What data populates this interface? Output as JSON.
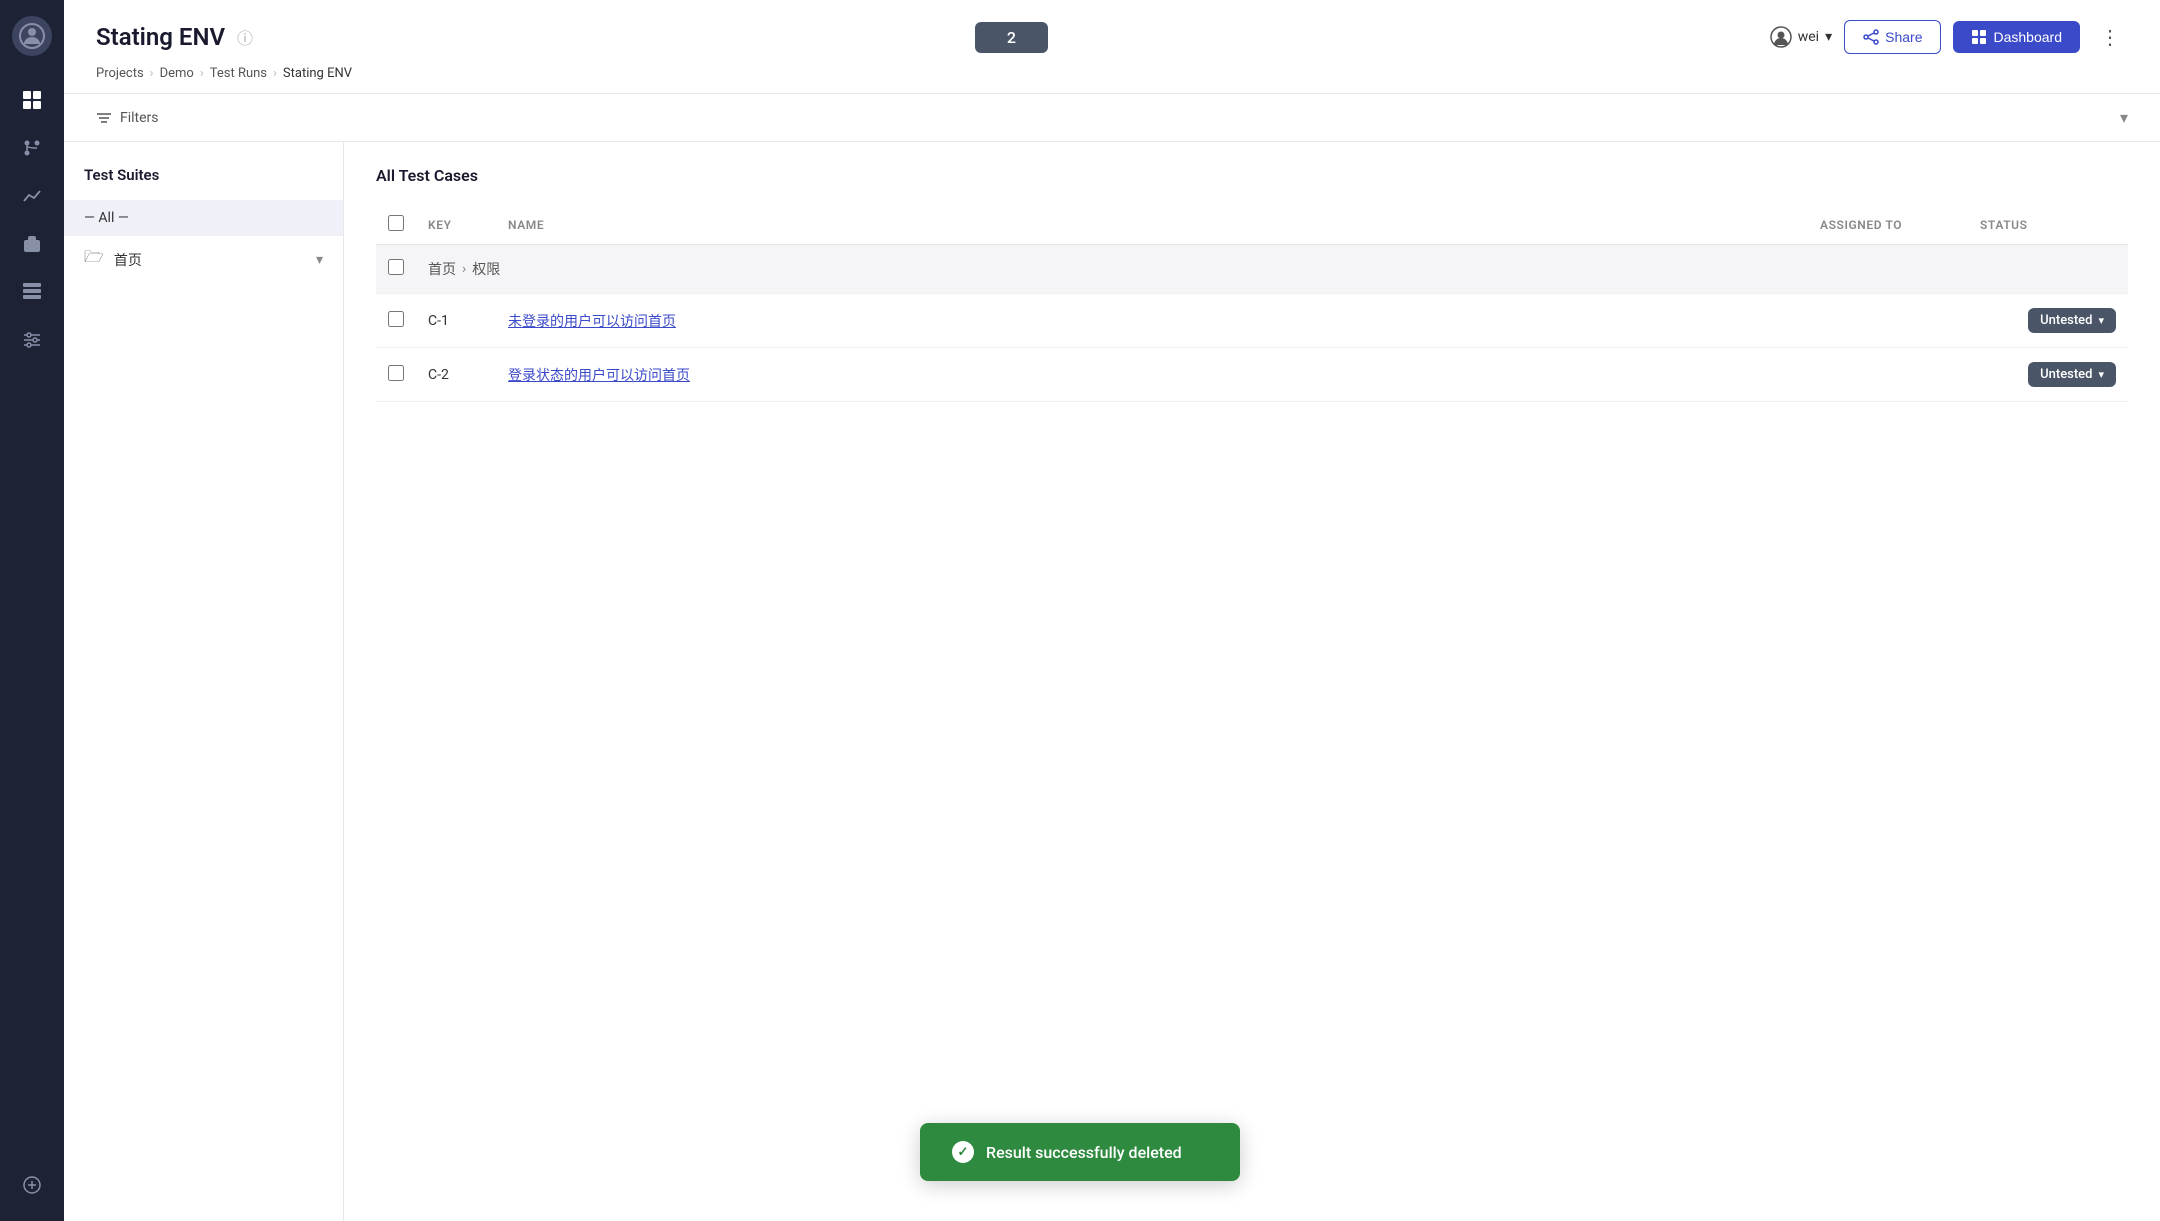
{
  "sidebar": {
    "logo_alt": "App Logo",
    "icons": [
      {
        "name": "dashboard-icon",
        "symbol": "📊"
      },
      {
        "name": "branches-icon",
        "symbol": "⑂"
      },
      {
        "name": "analytics-icon",
        "symbol": "📈"
      },
      {
        "name": "projects-icon",
        "symbol": "💼"
      },
      {
        "name": "table-icon",
        "symbol": "⊞"
      },
      {
        "name": "settings-icon",
        "symbol": "⚙"
      }
    ],
    "bottom_icon": {
      "name": "expand-icon",
      "symbol": "⊕"
    }
  },
  "header": {
    "title": "Stating ENV",
    "run_number": "2",
    "share_label": "Share",
    "dashboard_label": "Dashboard",
    "user_name": "wei",
    "breadcrumb": {
      "projects": "Projects",
      "demo": "Demo",
      "test_runs": "Test Runs",
      "current": "Stating ENV"
    }
  },
  "filters": {
    "label": "Filters"
  },
  "suites": {
    "title": "Test Suites",
    "all_label": "— All —",
    "items": [
      {
        "key": "首页",
        "label": "首页"
      }
    ]
  },
  "cases": {
    "title": "All Test Cases",
    "columns": {
      "key": "KEY",
      "name": "NAME",
      "assigned_to": "ASSIGNED TO",
      "status": "STATUS"
    },
    "groups": [
      {
        "path_part1": "首页",
        "path_sep": "›",
        "path_part2": "权限",
        "items": [
          {
            "key": "C-1",
            "name": "未登录的用户可以访问首页",
            "assigned_to": "",
            "status": "Untested"
          },
          {
            "key": "C-2",
            "name": "登录状态的用户可以访问首页",
            "assigned_to": "",
            "status": "Untested"
          }
        ]
      }
    ]
  },
  "toast": {
    "message": "Result successfully deleted"
  }
}
